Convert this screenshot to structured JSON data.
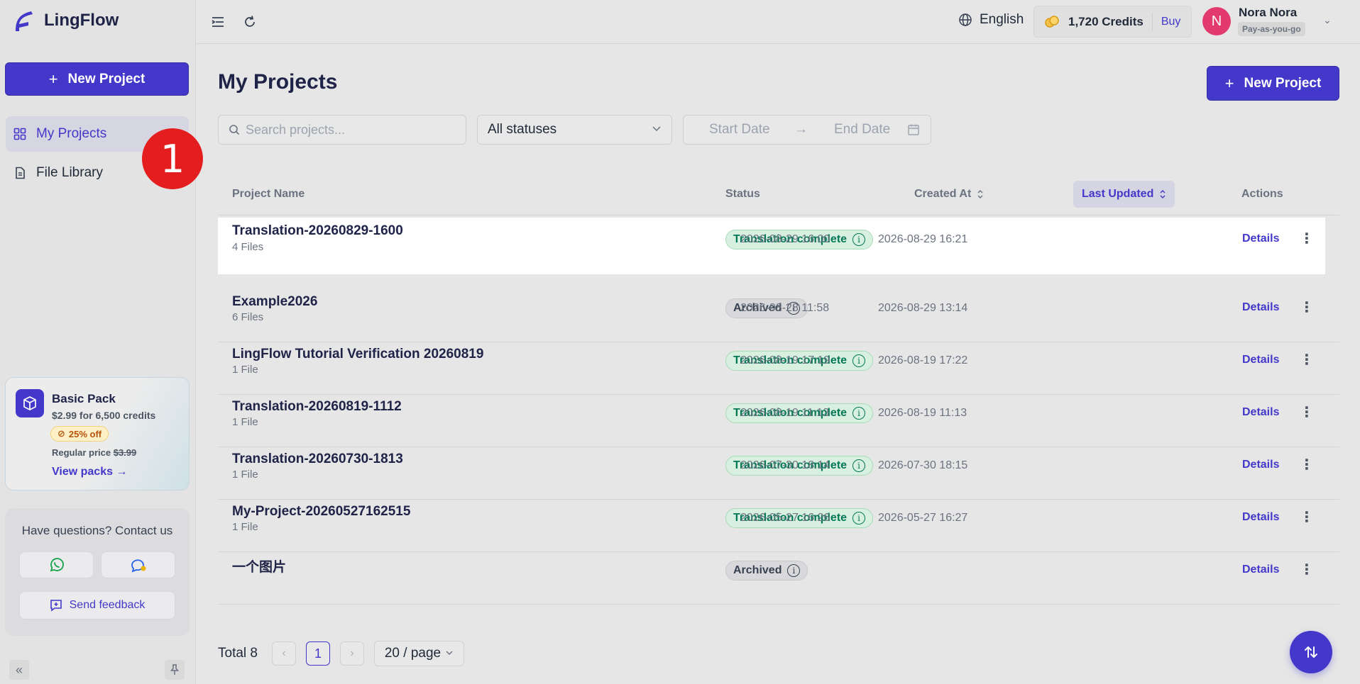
{
  "app": {
    "name": "LingFlow",
    "brand_color": "#4338ca"
  },
  "sidebar": {
    "new_project_label": "New Project",
    "items": [
      {
        "label": "My Projects",
        "icon": "grid-icon",
        "active": true
      },
      {
        "label": "File Library",
        "icon": "document-icon",
        "active": false
      }
    ],
    "step_badge": "1",
    "promo": {
      "title": "Basic Pack",
      "price": "$2.99 for 6,500 credits",
      "discount": "25% off",
      "regular_label": "Regular price",
      "regular_price": "$3.99",
      "link": "View packs"
    },
    "contact": {
      "title": "Have questions? Contact us",
      "feedback_label": "Send feedback"
    }
  },
  "topbar": {
    "language": "English",
    "credits": "1,720 Credits",
    "buy_label": "Buy",
    "user": {
      "initial": "N",
      "name": "Nora Nora",
      "plan": "Pay-as-you-go"
    }
  },
  "main": {
    "title": "My Projects",
    "new_project_label": "New Project",
    "search": {
      "placeholder": "Search projects..."
    },
    "status_filter": "All statuses",
    "date_range": {
      "start_placeholder": "Start Date",
      "end_placeholder": "End Date"
    },
    "columns": {
      "name": "Project Name",
      "status": "Status",
      "created": "Created At",
      "updated": "Last Updated",
      "actions": "Actions"
    },
    "rows": [
      {
        "name": "Translation-20260829-1600",
        "files": "4 Files",
        "status": "Translation complete",
        "status_type": "complete",
        "created": "2026-08-29 16:00",
        "updated": "2026-08-29 16:21",
        "action": "Details"
      },
      {
        "name": "Example2026",
        "files": "6 Files",
        "status": "Archived",
        "status_type": "archived",
        "created": "2026-08-28 11:58",
        "updated": "2026-08-29 13:14",
        "action": "Details"
      },
      {
        "name": "LingFlow Tutorial Verification 20260819",
        "files": "1 File",
        "status": "Translation complete",
        "status_type": "complete",
        "created": "2026-08-19 17:19",
        "updated": "2026-08-19 17:22",
        "action": "Details"
      },
      {
        "name": "Translation-20260819-1112",
        "files": "1 File",
        "status": "Translation complete",
        "status_type": "complete",
        "created": "2026-08-19 11:13",
        "updated": "2026-08-19 11:13",
        "action": "Details"
      },
      {
        "name": "Translation-20260730-1813",
        "files": "1 File",
        "status": "Translation complete",
        "status_type": "complete",
        "created": "2026-07-30 18:14",
        "updated": "2026-07-30 18:15",
        "action": "Details"
      },
      {
        "name": "My-Project-20260527162515",
        "files": "1 File",
        "status": "Translation complete",
        "status_type": "complete",
        "created": "2026-05-27 16:26",
        "updated": "2026-05-27 16:27",
        "action": "Details"
      },
      {
        "name": "一个图片",
        "files": "",
        "status": "Archived",
        "status_type": "archived",
        "created": "",
        "updated": "",
        "action": "Details"
      }
    ],
    "pagination": {
      "total": "Total 8",
      "current_page": "1",
      "per_page": "20 / page"
    }
  }
}
